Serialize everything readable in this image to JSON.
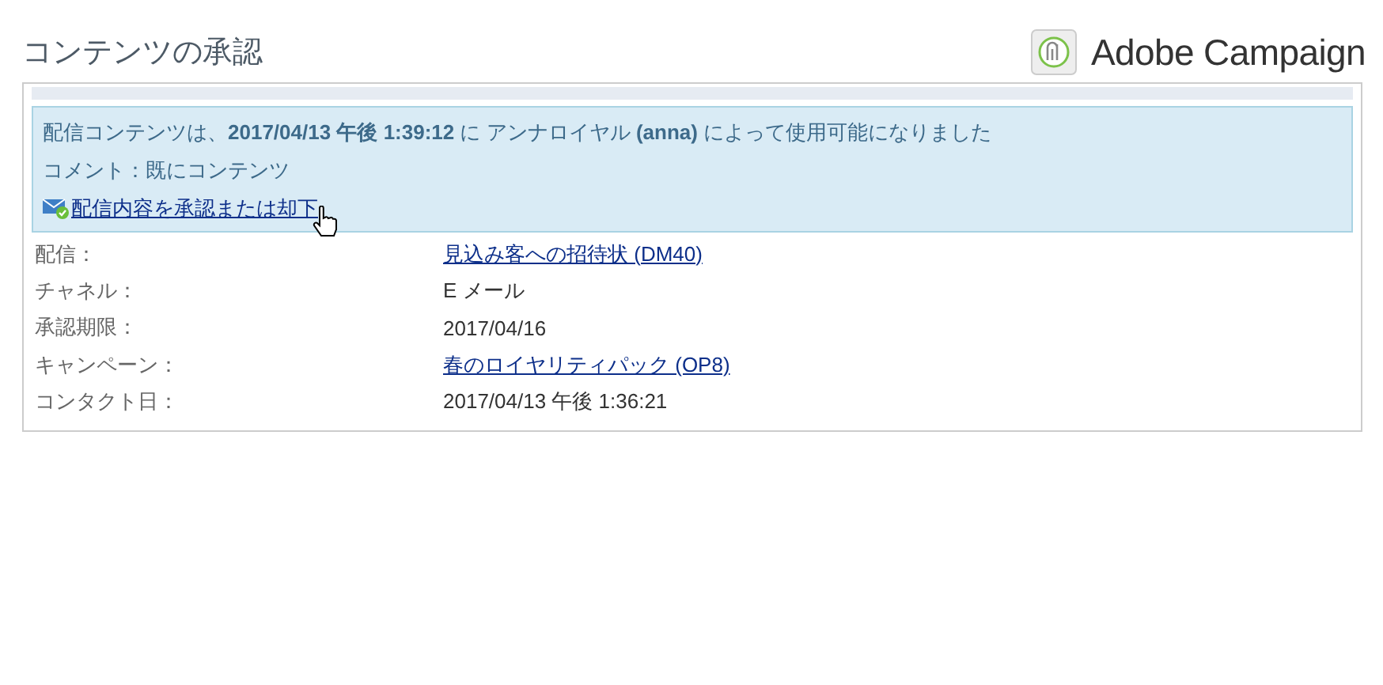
{
  "page_title": "コンテンツの承認",
  "brand": {
    "name": "Adobe Campaign"
  },
  "notice": {
    "message": "配信コンテンツは、**2017/04/13** **午後 1:39:12** に アンナロイヤル **(anna)** によって使用可能になりました",
    "comment": "コメント：既にコンテンツ",
    "action_link": "配信内容を承認または却下"
  },
  "details": [
    {
      "label": "配信：",
      "value": "見込み客への招待状 (DM40)",
      "kind": "link"
    },
    {
      "label": "チャネル：",
      "value": "E メール",
      "kind": "text"
    },
    {
      "label": "承認期限：",
      "value": "2017/04/16",
      "kind": "text"
    },
    {
      "label": "キャンペーン：",
      "value": "春のロイヤリティパック (OP8)",
      "kind": "link"
    },
    {
      "label": "コンタクト日：",
      "value": "2017/04/13 午後 1:36:21",
      "kind": "text"
    }
  ]
}
